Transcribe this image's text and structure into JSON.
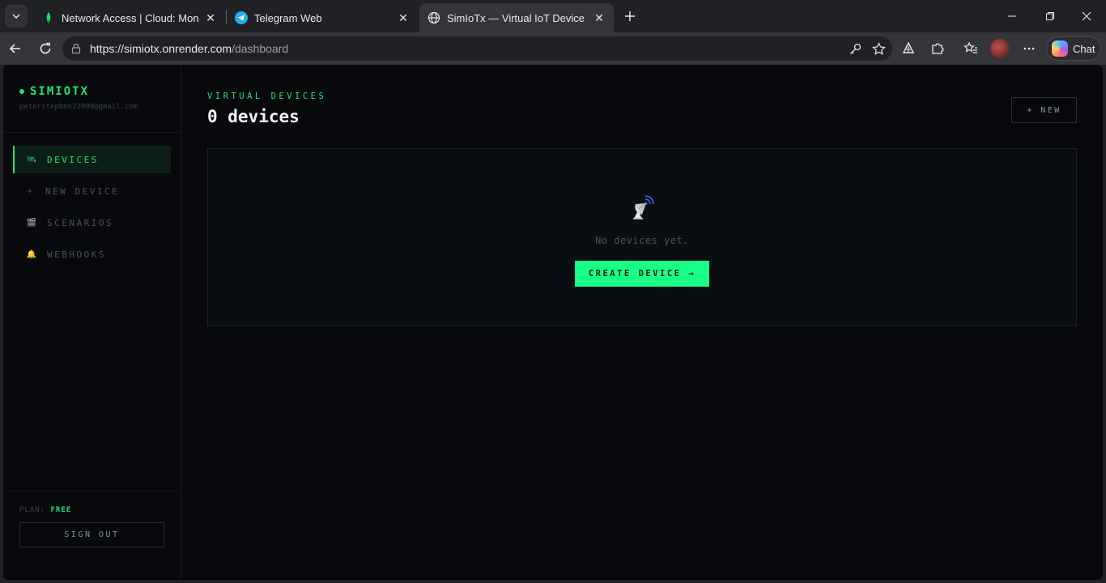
{
  "browser": {
    "tabs": [
      {
        "title": "Network Access | Cloud: MongoDB",
        "icon": "mongodb-leaf-icon"
      },
      {
        "title": "Telegram Web",
        "icon": "telegram-icon"
      },
      {
        "title": "SimIoTx — Virtual IoT Device Simulator",
        "icon": "globe-icon"
      }
    ],
    "url_host": "https://simiotx.onrender.com",
    "url_path": "/dashboard",
    "chat_label": "Chat"
  },
  "sidebar": {
    "brand": "SIMIOTX",
    "email": "peterstephen22000@gmail.com",
    "items": [
      {
        "icon": "🛰",
        "label": "DEVICES"
      },
      {
        "icon": "+",
        "label": "NEW DEVICE"
      },
      {
        "icon": "🎬",
        "label": "SCENARIOS"
      },
      {
        "icon": "🔔",
        "label": "WEBHOOKS"
      }
    ],
    "plan_label": "PLAN:",
    "plan_value": "FREE",
    "sign_out": "SIGN OUT"
  },
  "main": {
    "eyebrow": "VIRTUAL DEVICES",
    "heading": "0 devices",
    "new_button": "+ NEW",
    "empty_text": "No devices yet.",
    "create_button": "CREATE DEVICE →"
  },
  "colors": {
    "accent": "#22e37a",
    "button": "#1aff86",
    "background": "#07090d"
  }
}
